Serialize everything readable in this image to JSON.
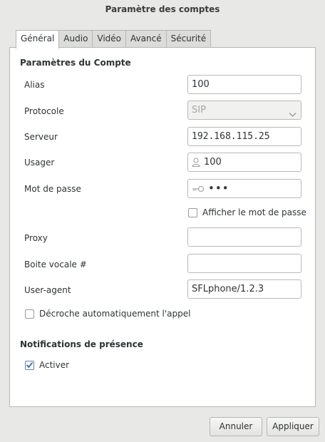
{
  "window": {
    "title": "Paramètre des comptes"
  },
  "tabs": [
    {
      "label": "Général"
    },
    {
      "label": "Audio"
    },
    {
      "label": "Vidéo"
    },
    {
      "label": "Avancé"
    },
    {
      "label": "Sécurité"
    }
  ],
  "account": {
    "section_title": "Paramètres du Compte",
    "alias": {
      "label": "Alias",
      "value": "100"
    },
    "protocol": {
      "label": "Protocole",
      "value": "SIP",
      "options": [
        "SIP"
      ]
    },
    "server": {
      "label": "Serveur",
      "value": "192.168.115.25"
    },
    "user": {
      "label": "Usager",
      "value": "100",
      "icon": "user-icon"
    },
    "password": {
      "label": "Mot de passe",
      "value": "•••",
      "icon": "key-icon"
    },
    "show_password": {
      "label": "Afficher le mot de passe",
      "checked": false
    },
    "proxy": {
      "label": "Proxy",
      "value": ""
    },
    "voicemail": {
      "label": "Boite vocale #",
      "value": ""
    },
    "user_agent": {
      "label": "User-agent",
      "value": "SFLphone/1.2.3"
    },
    "auto_answer": {
      "label": "Décroche automatiquement l'appel",
      "checked": false
    }
  },
  "presence": {
    "section_title": "Notifications de présence",
    "activate": {
      "label": "Activer",
      "checked": true
    }
  },
  "buttons": {
    "cancel": "Annuler",
    "apply": "Appliquer"
  },
  "colors": {
    "window_bg": "#e8e8e7",
    "panel_bg": "#ffffff",
    "border": "#b6b6b3",
    "check_accent": "#5f87b5"
  }
}
